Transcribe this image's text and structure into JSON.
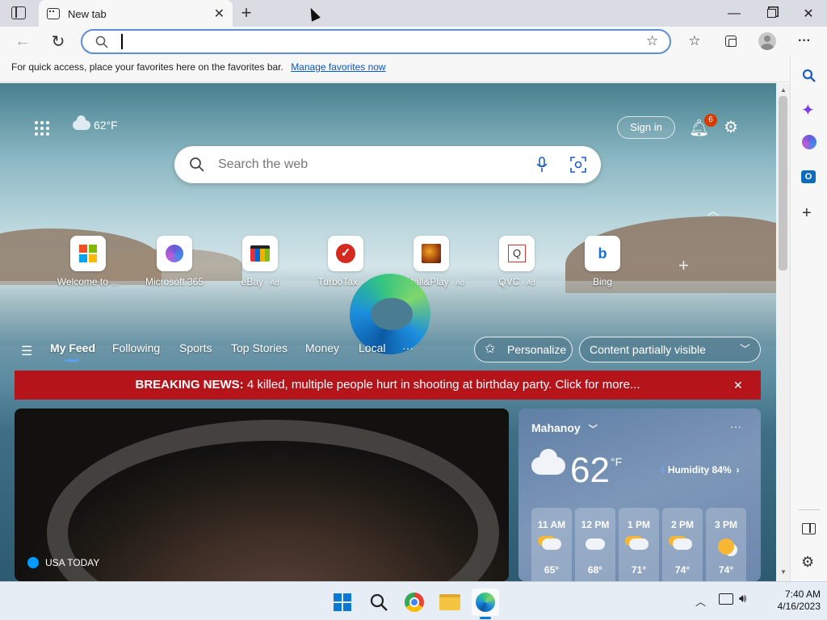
{
  "browser": {
    "tab_title": "New tab",
    "address_value": "",
    "favbar_text": "For quick access, place your favorites here on the favorites bar.",
    "favbar_link": "Manage favorites now"
  },
  "ntp": {
    "weather_temp": "62°F",
    "sign_in": "Sign in",
    "notification_count": "6",
    "search_placeholder": "Search the web",
    "tiles": [
      {
        "label": "Welcome to ...",
        "ad": ""
      },
      {
        "label": "Microsoft 365",
        "ad": ""
      },
      {
        "label": "eBay",
        "ad": "· Ad"
      },
      {
        "label": "TurboTax",
        "ad": "· Ad"
      },
      {
        "label": "Install&Play",
        "ad": "· Ad"
      },
      {
        "label": "QVC",
        "ad": "· Ad"
      },
      {
        "label": "Bing",
        "ad": ""
      }
    ],
    "feed_tabs": [
      "My Feed",
      "Following",
      "Sports",
      "Top Stories",
      "Money",
      "Local",
      "···"
    ],
    "personalize": "Personalize",
    "content_visibility": "Content partially visible",
    "breaking_label": "BREAKING NEWS:",
    "breaking_text": "4 killed, multiple people hurt in shooting at birthday party. Click for more...",
    "article_source": "USA TODAY"
  },
  "weather_card": {
    "location": "Mahanoy",
    "temp": "62",
    "unit": "°F",
    "humidity": "Humidity 84%",
    "hours": [
      {
        "time": "11 AM",
        "temp": "65°"
      },
      {
        "time": "12 PM",
        "temp": "68°"
      },
      {
        "time": "1 PM",
        "temp": "71°"
      },
      {
        "time": "2 PM",
        "temp": "74°"
      },
      {
        "time": "3 PM",
        "temp": "74°"
      }
    ]
  },
  "taskbar": {
    "time": "7:40 AM",
    "date": "4/16/2023"
  },
  "colors": {
    "breaking_bg": "#b5141b",
    "accent": "#0a58c2"
  }
}
